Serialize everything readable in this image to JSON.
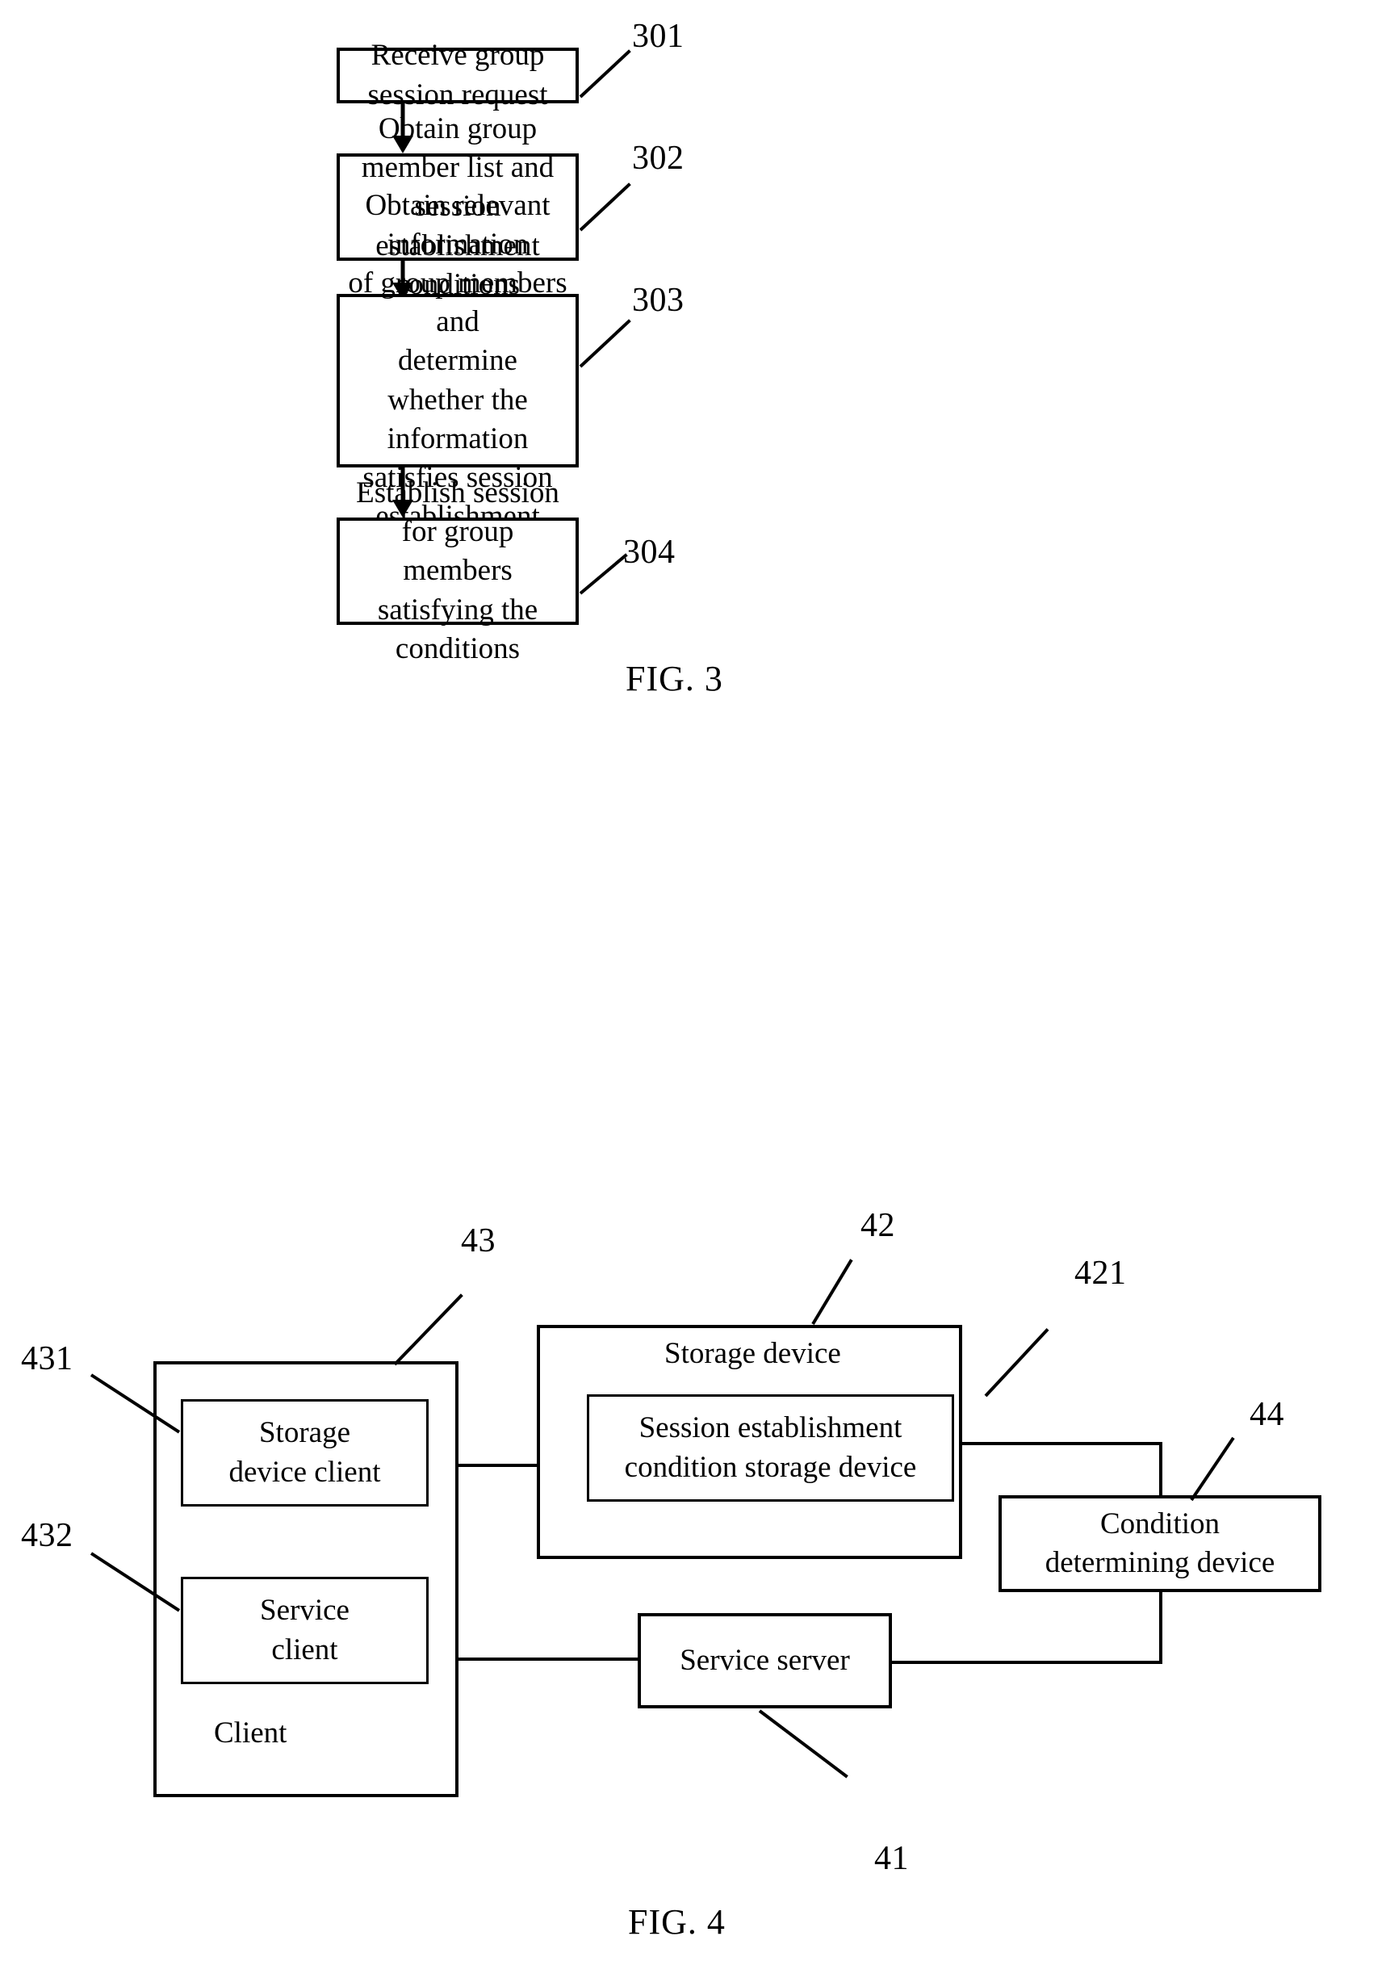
{
  "figures": [
    {
      "id": "fig3",
      "caption": "FIG. 3",
      "steps": [
        {
          "ref": "301",
          "lines": [
            "Receive group session request"
          ]
        },
        {
          "ref": "302",
          "lines": [
            "Obtain group member list and",
            "session establishment",
            "conditions"
          ]
        },
        {
          "ref": "303",
          "lines": [
            "Obtain relevant information",
            "of group members and",
            "determine whether the",
            "information satisfies session",
            "establishment conditions"
          ]
        },
        {
          "ref": "304",
          "lines": [
            "Establish session for group",
            "members satisfying the",
            "conditions"
          ]
        }
      ]
    },
    {
      "id": "fig4",
      "caption": "FIG. 4",
      "blocks": [
        {
          "ref": "43",
          "name": "client",
          "label": "Client"
        },
        {
          "ref": "431",
          "name": "storage-device-client",
          "lines": [
            "Storage",
            "device client"
          ]
        },
        {
          "ref": "432",
          "name": "service-client",
          "lines": [
            "Service",
            "client"
          ]
        },
        {
          "ref": "42",
          "name": "storage-device",
          "label": "Storage device"
        },
        {
          "ref": "421",
          "name": "session-condition-storage",
          "lines": [
            "Session establishment",
            "condition storage device"
          ]
        },
        {
          "ref": "44",
          "name": "condition-determining",
          "lines": [
            "Condition",
            "determining device"
          ]
        },
        {
          "ref": "41",
          "name": "service-server",
          "label": "Service server"
        }
      ]
    }
  ],
  "fig3": {
    "caption": "FIG. 3",
    "step1": {
      "ref": "301",
      "l1": "Receive group session request"
    },
    "step2": {
      "ref": "302",
      "l1": "Obtain group member list and",
      "l2": "session establishment",
      "l3": "conditions"
    },
    "step3": {
      "ref": "303",
      "l1": "Obtain relevant information",
      "l2": "of group members and",
      "l3": "determine whether the",
      "l4": "information satisfies session",
      "l5": "establishment conditions"
    },
    "step4": {
      "ref": "304",
      "l1": "Establish session for group",
      "l2": "members satisfying the",
      "l3": "conditions"
    }
  },
  "fig4": {
    "caption": "FIG. 4",
    "client": {
      "ref": "43",
      "label": "Client"
    },
    "storage_device_client": {
      "ref": "431",
      "l1": "Storage",
      "l2": "device client"
    },
    "service_client": {
      "ref": "432",
      "l1": "Service",
      "l2": "client"
    },
    "storage_device": {
      "ref": "42",
      "label": "Storage device"
    },
    "session_condition": {
      "ref": "421",
      "l1": "Session establishment",
      "l2": "condition storage device"
    },
    "condition_determining": {
      "ref": "44",
      "l1": "Condition",
      "l2": "determining device"
    },
    "service_server": {
      "ref": "41",
      "label": "Service server"
    }
  },
  "colors": {
    "ink": "#000000",
    "paper": "#ffffff"
  }
}
